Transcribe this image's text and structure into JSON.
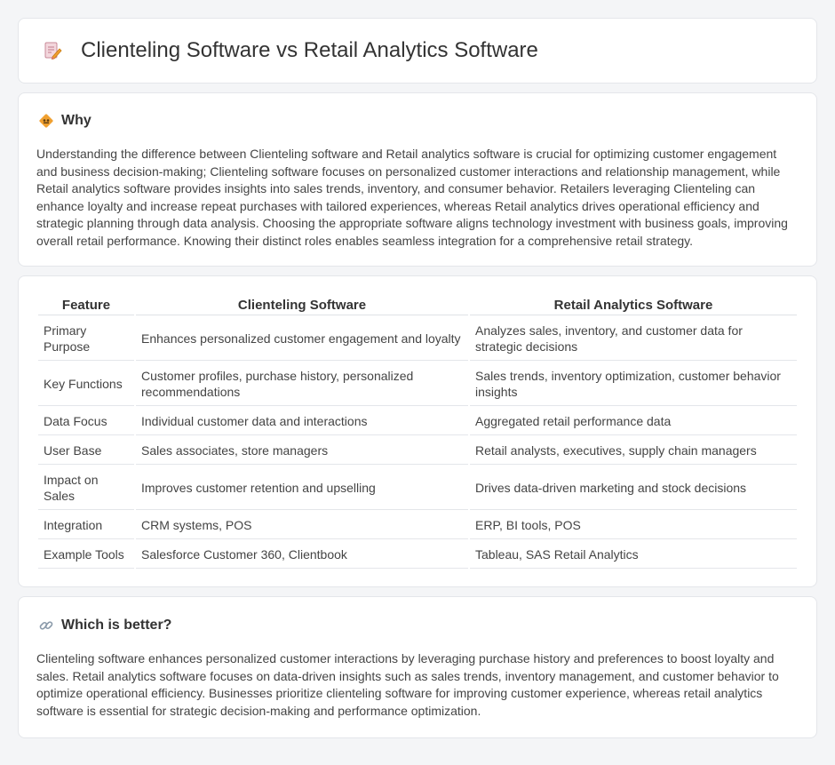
{
  "header": {
    "title": "Clienteling Software vs Retail Analytics Software",
    "icon": "document-pencil-icon"
  },
  "why": {
    "title": "Why",
    "icon": "diamond-sign-icon",
    "text": "Understanding the difference between Clienteling software and Retail analytics software is crucial for optimizing customer engagement and business decision-making; Clienteling software focuses on personalized customer interactions and relationship management, while Retail analytics software provides insights into sales trends, inventory, and consumer behavior. Retailers leveraging Clienteling can enhance loyalty and increase repeat purchases with tailored experiences, whereas Retail analytics drives operational efficiency and strategic planning through data analysis. Choosing the appropriate software aligns technology investment with business goals, improving overall retail performance. Knowing their distinct roles enables seamless integration for a comprehensive retail strategy."
  },
  "table": {
    "headers": [
      "Feature",
      "Clienteling Software",
      "Retail Analytics Software"
    ],
    "rows": [
      [
        "Primary Purpose",
        "Enhances personalized customer engagement and loyalty",
        "Analyzes sales, inventory, and customer data for strategic decisions"
      ],
      [
        "Key Functions",
        "Customer profiles, purchase history, personalized recommendations",
        "Sales trends, inventory optimization, customer behavior insights"
      ],
      [
        "Data Focus",
        "Individual customer data and interactions",
        "Aggregated retail performance data"
      ],
      [
        "User Base",
        "Sales associates, store managers",
        "Retail analysts, executives, supply chain managers"
      ],
      [
        "Impact on Sales",
        "Improves customer retention and upselling",
        "Drives data-driven marketing and stock decisions"
      ],
      [
        "Integration",
        "CRM systems, POS",
        "ERP, BI tools, POS"
      ],
      [
        "Example Tools",
        "Salesforce Customer 360, Clientbook",
        "Tableau, SAS Retail Analytics"
      ]
    ]
  },
  "better": {
    "title": "Which is better?",
    "icon": "link-icon",
    "text": "Clienteling software enhances personalized customer interactions by leveraging purchase history and preferences to boost loyalty and sales. Retail analytics software focuses on data-driven insights such as sales trends, inventory management, and customer behavior to optimize operational efficiency. Businesses prioritize clienteling software for improving customer experience, whereas retail analytics software is essential for strategic decision-making and performance optimization."
  },
  "colors": {
    "background": "#f4f5f7",
    "card": "#ffffff",
    "accent_orange": "#f0a030",
    "icon_pink": "#e0607a"
  }
}
